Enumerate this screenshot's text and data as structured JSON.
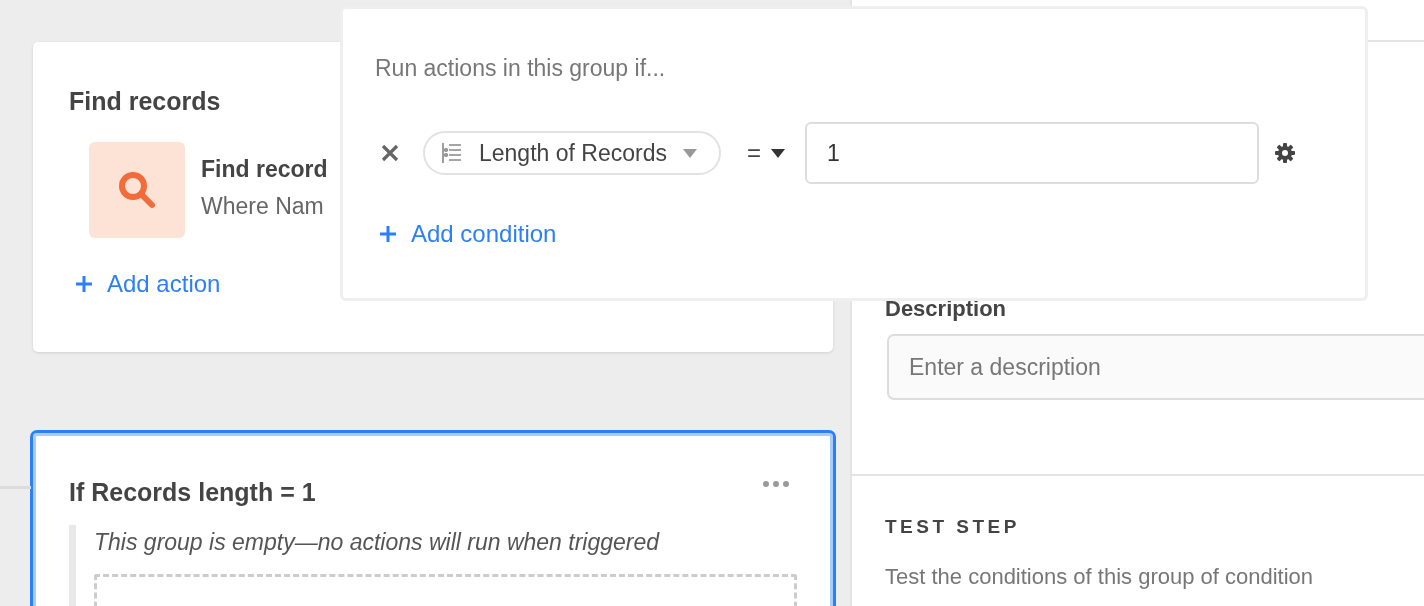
{
  "canvas": {
    "find_card": {
      "title": "Find records",
      "action": {
        "name": "Find record",
        "detail": "Where Nam"
      },
      "add_action": "Add action"
    },
    "group_card": {
      "title": "If Records length = 1",
      "selected": true,
      "empty_message": "This group is empty—no actions will run when triggered"
    }
  },
  "popover": {
    "heading": "Run actions in this group if...",
    "conditions": [
      {
        "field": "Length of Records",
        "operator": "=",
        "value": "1"
      }
    ],
    "add_condition": "Add condition"
  },
  "panel": {
    "description": {
      "label": "Description",
      "placeholder": "Enter a description"
    },
    "test_step": {
      "heading": "TEST STEP",
      "text": "Test the conditions of this group of condition"
    }
  }
}
